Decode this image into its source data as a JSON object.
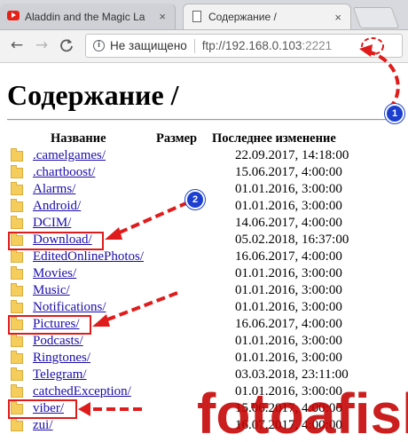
{
  "browser": {
    "tabs": [
      {
        "title": "Aladdin and the Magic La",
        "icon": "youtube-icon",
        "active": false
      },
      {
        "title": "Содержание /",
        "icon": "document-icon",
        "active": true
      }
    ],
    "tab_close_glyph": "×",
    "nav": {
      "back": "←",
      "forward": "→",
      "reload": "C"
    },
    "address": {
      "security_label": "Не защищено",
      "url_host": "ftp://192.168.0.103",
      "url_port": ":2221"
    }
  },
  "page": {
    "title": "Содержание /",
    "headers": {
      "name": "Название",
      "size": "Размер",
      "modified": "Последнее изменение"
    },
    "rows": [
      {
        "name": ".camelgames/",
        "date": "22.09.2017, 14:18:00"
      },
      {
        "name": ".chartboost/",
        "date": "15.06.2017, 4:00:00"
      },
      {
        "name": "Alarms/",
        "date": "01.01.2016, 3:00:00"
      },
      {
        "name": "Android/",
        "date": "01.01.2016, 3:00:00"
      },
      {
        "name": "DCIM/",
        "date": "14.06.2017, 4:00:00"
      },
      {
        "name": "Download/",
        "date": "05.02.2018, 16:37:00"
      },
      {
        "name": "EditedOnlinePhotos/",
        "date": "16.06.2017, 4:00:00"
      },
      {
        "name": "Movies/",
        "date": "01.01.2016, 3:00:00"
      },
      {
        "name": "Music/",
        "date": "01.01.2016, 3:00:00"
      },
      {
        "name": "Notifications/",
        "date": "01.01.2016, 3:00:00"
      },
      {
        "name": "Pictures/",
        "date": "16.06.2017, 4:00:00"
      },
      {
        "name": "Podcasts/",
        "date": "01.01.2016, 3:00:00"
      },
      {
        "name": "Ringtones/",
        "date": "01.01.2016, 3:00:00"
      },
      {
        "name": "Telegram/",
        "date": "03.03.2018, 23:11:00"
      },
      {
        "name": "catchedException/",
        "date": "01.01.2016, 3:00:00"
      },
      {
        "name": "viber/",
        "date": "15.06.2017, 4:00:00"
      },
      {
        "name": "zui/",
        "date": "16.07.2017, 4:00:00"
      }
    ]
  },
  "annotations": {
    "badges": [
      "1",
      "2"
    ],
    "watermark": "fotoafisha",
    "accent_color": "#e01b1b",
    "badge_color": "#1c3fd0"
  }
}
